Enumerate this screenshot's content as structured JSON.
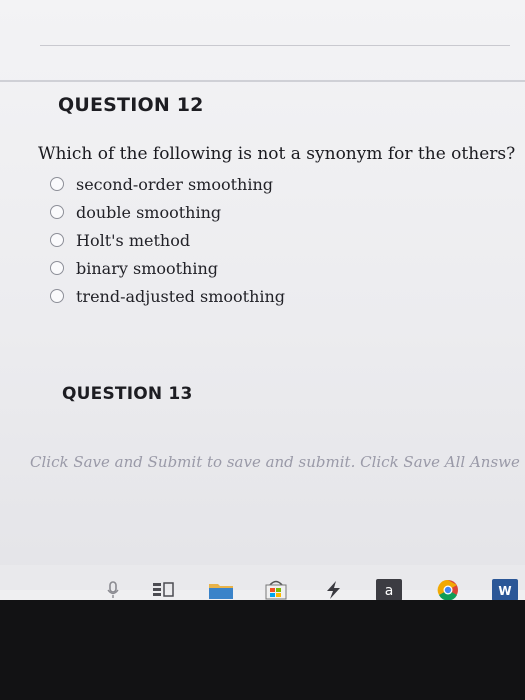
{
  "question12": {
    "title": "QUESTION 12",
    "prompt": "Which of the following is not a synonym for the others?",
    "choices": [
      "second-order smoothing",
      "double smoothing",
      "Holt's method",
      "binary smoothing",
      "trend-adjusted smoothing"
    ]
  },
  "question13": {
    "title": "QUESTION 13"
  },
  "footer": {
    "note": "Click Save and Submit to save and submit. Click Save All Answe"
  },
  "taskbar": {
    "icons": [
      {
        "name": "microphone-icon",
        "glyph": "▮"
      },
      {
        "name": "task-view-icon",
        "glyph": "≡"
      },
      {
        "name": "folder-icon",
        "glyph": ""
      },
      {
        "name": "store-icon",
        "glyph": ""
      },
      {
        "name": "bolt-icon",
        "glyph": "ϟ"
      },
      {
        "name": "amazon-icon",
        "glyph": "a"
      },
      {
        "name": "chrome-icon",
        "glyph": ""
      },
      {
        "name": "word-icon",
        "glyph": "W"
      }
    ]
  },
  "colors": {
    "page_bg": "#f0f0f2",
    "text": "#1a1a1f",
    "radio_border": "#8d8f98",
    "footer_text": "#9a9aa8",
    "taskbar_dark": "#121214"
  }
}
